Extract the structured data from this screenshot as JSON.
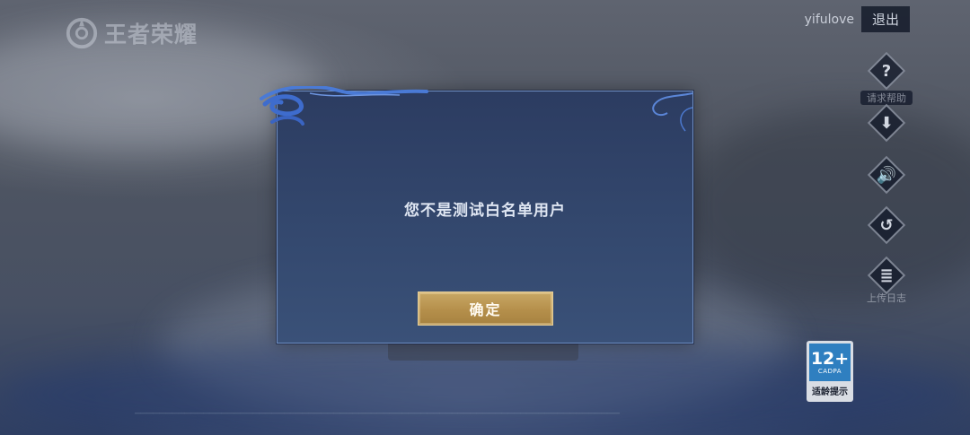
{
  "logo": {
    "text": "王者荣耀",
    "icon": "game-logo-icon"
  },
  "account": {
    "username": "yifulove",
    "logout_label": "退出"
  },
  "side_tools": [
    {
      "name": "help",
      "icon": "question-icon",
      "glyph": "?",
      "caption": "请求帮助"
    },
    {
      "name": "download",
      "icon": "download-icon",
      "glyph": "⬇"
    },
    {
      "name": "sound",
      "icon": "speaker-icon",
      "glyph": "🔊"
    },
    {
      "name": "repair",
      "icon": "repair-icon",
      "glyph": "↺"
    },
    {
      "name": "upload-log",
      "icon": "clipboard-icon",
      "glyph": "≣",
      "caption": "上传日志"
    }
  ],
  "age_rating": {
    "number": "12+",
    "org": "CADPA",
    "label": "适龄提示"
  },
  "dialog": {
    "message": "您不是测试白名单用户",
    "confirm_label": "确定"
  },
  "colors": {
    "dialog_bg": "#34496f",
    "dialog_border": "#6f8fc4",
    "confirm_gold": "#b58f4b"
  }
}
